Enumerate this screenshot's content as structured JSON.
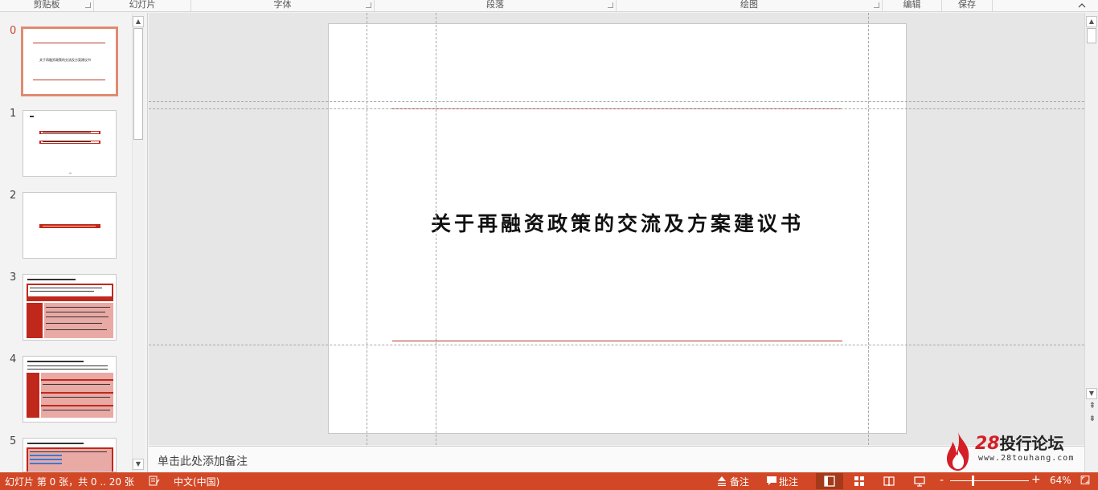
{
  "ribbon": {
    "groups": [
      {
        "label": "剪贴板"
      },
      {
        "label": "幻灯片"
      },
      {
        "label": "字体"
      },
      {
        "label": "段落"
      },
      {
        "label": "绘图"
      },
      {
        "label": "编辑"
      },
      {
        "label": "保存"
      }
    ]
  },
  "thumbnails": {
    "items": [
      {
        "number": "0",
        "text": "关于再融资政策的交流及方案建议书"
      },
      {
        "number": "1"
      },
      {
        "number": "2"
      },
      {
        "number": "3"
      },
      {
        "number": "4"
      },
      {
        "number": "5"
      }
    ]
  },
  "slide": {
    "title": "关于再融资政策的交流及方案建议书"
  },
  "notes": {
    "placeholder": "单击此处添加备注"
  },
  "watermark": {
    "brand_number": "28",
    "brand_text": "投行论坛",
    "url": "www.28touhang.com"
  },
  "status": {
    "slide_info": "幻灯片 第 0 张，共 0 .. 20 张",
    "language": "中文(中国)",
    "notes_label": "备注",
    "comments_label": "批注",
    "zoom_minus": "-",
    "zoom_plus": "+",
    "zoom_level": "64%"
  },
  "colors": {
    "accent": "#d24726",
    "slide_line": "#b8322a",
    "brand_red": "#d41f26"
  }
}
